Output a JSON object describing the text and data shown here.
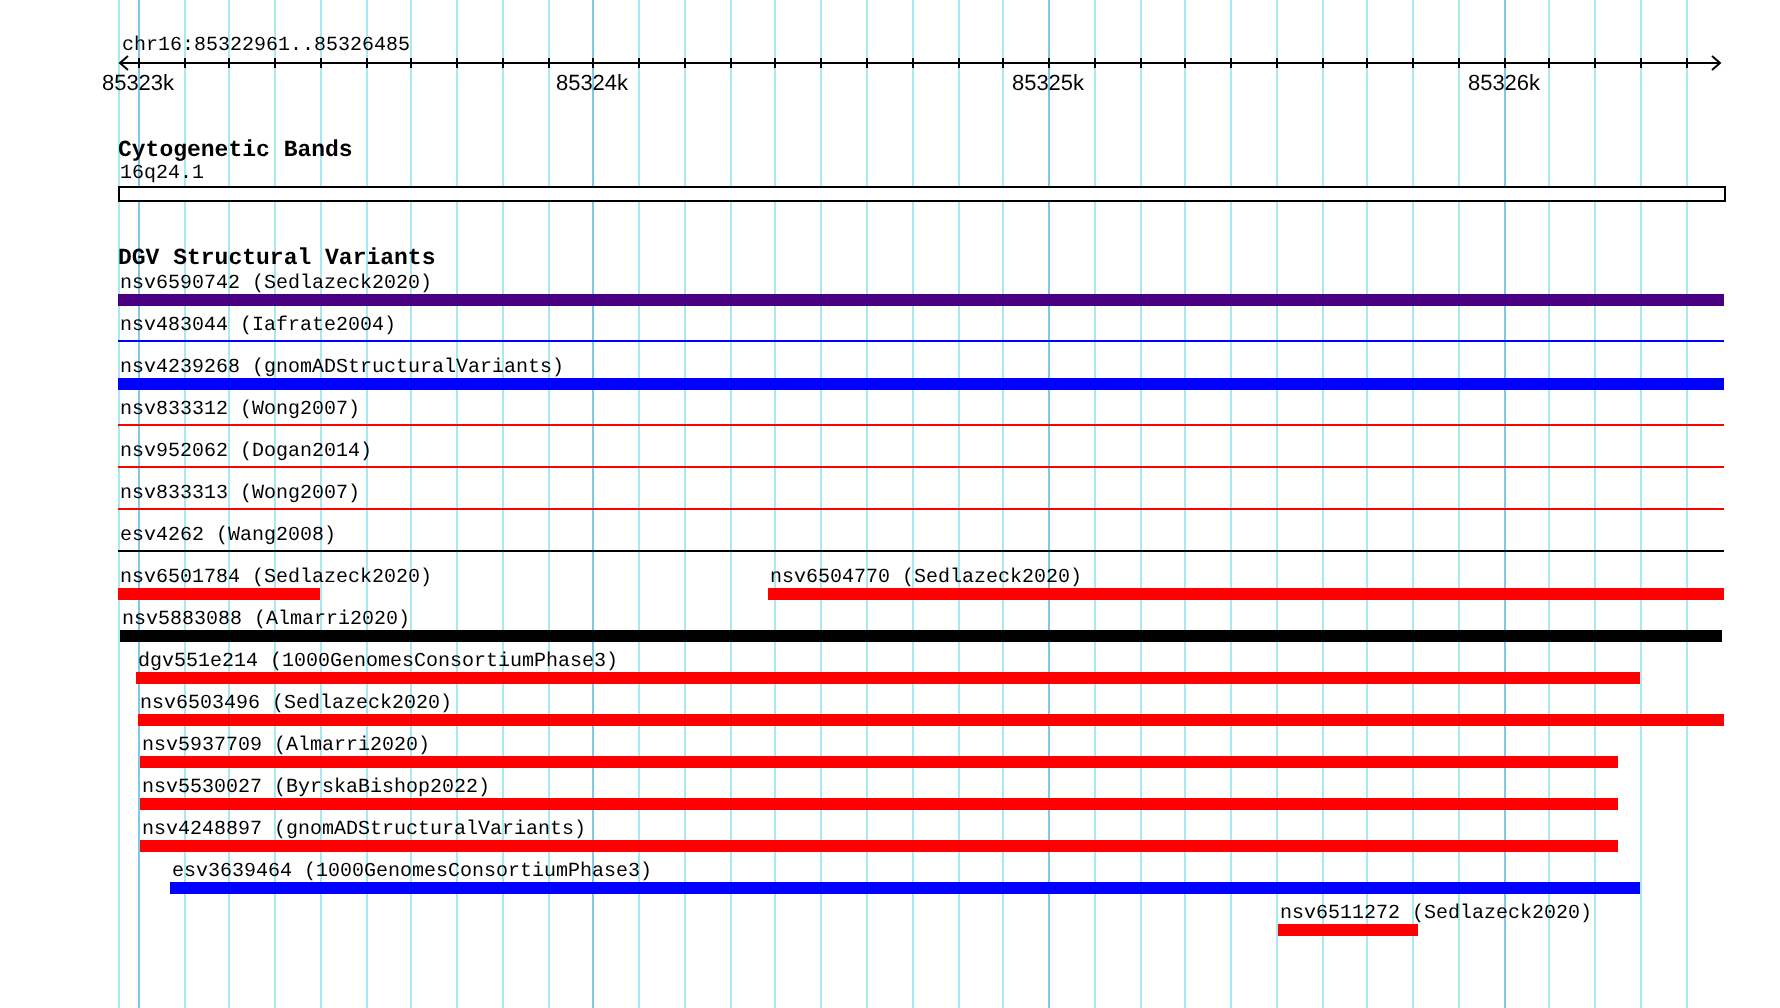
{
  "ruler": {
    "range": "chr16:85322961..85326485",
    "ticks": [
      "85323k",
      "85324k",
      "85325k",
      "85326k"
    ]
  },
  "tracks": [
    {
      "title": "Cytogenetic Bands",
      "features": [
        {
          "label": "16q24.1",
          "kind": "band",
          "color": "#000000"
        }
      ]
    },
    {
      "title": "DGV Structural Variants",
      "features": [
        {
          "label": "nsv6590742 (Sedlazeck2020)",
          "kind": "bar",
          "color": "#4b0082"
        },
        {
          "label": "nsv483044 (Iafrate2004)",
          "kind": "line",
          "color": "#0000ff"
        },
        {
          "label": "nsv4239268 (gnomADStructuralVariants)",
          "kind": "bar",
          "color": "#0000ff"
        },
        {
          "label": "nsv833312 (Wong2007)",
          "kind": "line",
          "color": "#ff0000"
        },
        {
          "label": "nsv952062 (Dogan2014)",
          "kind": "line",
          "color": "#ff0000"
        },
        {
          "label": "nsv833313 (Wong2007)",
          "kind": "line",
          "color": "#ff0000"
        },
        {
          "label": "esv4262 (Wang2008)",
          "kind": "line",
          "color": "#000000"
        },
        {
          "label": "nsv6501784 (Sedlazeck2020)",
          "kind": "bar",
          "color": "#ff0000"
        },
        {
          "label": "nsv6504770 (Sedlazeck2020)",
          "kind": "bar",
          "color": "#ff0000"
        },
        {
          "label": "nsv5883088 (Almarri2020)",
          "kind": "bar",
          "color": "#000000"
        },
        {
          "label": "dgv551e214 (1000GenomesConsortiumPhase3)",
          "kind": "bar",
          "color": "#ff0000"
        },
        {
          "label": "nsv6503496 (Sedlazeck2020)",
          "kind": "bar",
          "color": "#ff0000"
        },
        {
          "label": "nsv5937709 (Almarri2020)",
          "kind": "bar",
          "color": "#ff0000"
        },
        {
          "label": "nsv5530027 (ByrskaBishop2022)",
          "kind": "bar",
          "color": "#ff0000"
        },
        {
          "label": "nsv4248897 (gnomADStructuralVariants)",
          "kind": "bar",
          "color": "#ff0000"
        },
        {
          "label": "esv3639464 (1000GenomesConsortiumPhase3)",
          "kind": "bar",
          "color": "#0000ff"
        },
        {
          "label": "nsv6511272 (Sedlazeck2020)",
          "kind": "bar",
          "color": "#ff0000"
        }
      ]
    }
  ]
}
